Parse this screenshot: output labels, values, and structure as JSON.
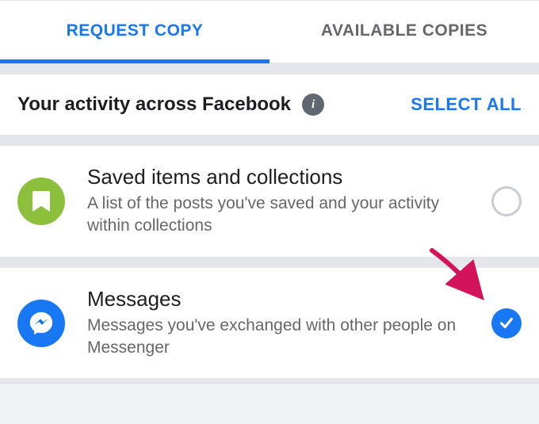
{
  "tabs": {
    "request": "REQUEST COPY",
    "available": "AVAILABLE COPIES"
  },
  "header": {
    "title": "Your activity across Facebook",
    "action": "SELECT ALL"
  },
  "items": [
    {
      "title": "Saved items and collections",
      "desc": "A list of the posts you've saved and your activity within collections",
      "checked": false
    },
    {
      "title": "Messages",
      "desc": "Messages you've exchanged with other people on Messenger",
      "checked": true
    }
  ]
}
